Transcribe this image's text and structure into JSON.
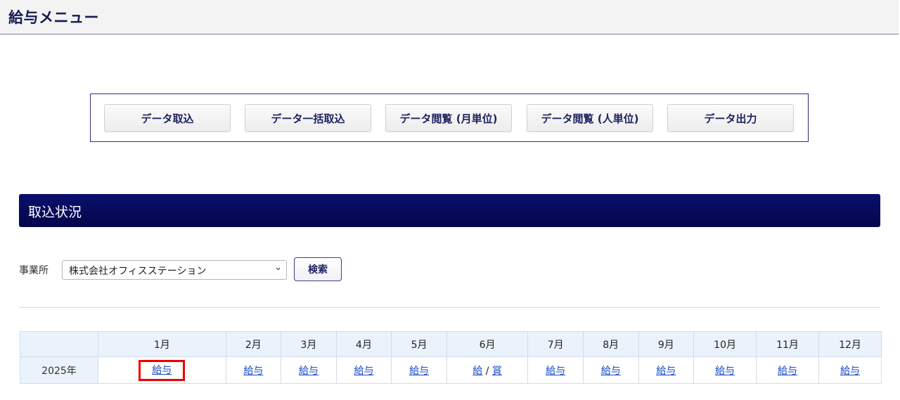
{
  "header": {
    "title": "給与メニュー"
  },
  "menu": {
    "buttons": [
      {
        "label": "データ取込"
      },
      {
        "label": "データ一括取込"
      },
      {
        "label": "データ閲覧 (月単位)"
      },
      {
        "label": "データ閲覧 (人単位)"
      },
      {
        "label": "データ出力"
      }
    ]
  },
  "section": {
    "title": "取込状況"
  },
  "filter": {
    "office_label": "事業所",
    "office_selected": "株式会社オフィスステーション",
    "search_label": "検索"
  },
  "table": {
    "months": [
      "1月",
      "2月",
      "3月",
      "4月",
      "5月",
      "6月",
      "7月",
      "8月",
      "9月",
      "10月",
      "11月",
      "12月"
    ],
    "rows": [
      {
        "year": "2025年",
        "cells": [
          {
            "links": [
              "給与"
            ],
            "highlighted": true
          },
          {
            "links": [
              "給与"
            ]
          },
          {
            "links": [
              "給与"
            ]
          },
          {
            "links": [
              "給与"
            ]
          },
          {
            "links": [
              "給与"
            ]
          },
          {
            "links": [
              "給",
              "賞"
            ],
            "separator": "/"
          },
          {
            "links": [
              "給与"
            ]
          },
          {
            "links": [
              "給与"
            ]
          },
          {
            "links": [
              "給与"
            ]
          },
          {
            "links": [
              "給与"
            ]
          },
          {
            "links": [
              "給与"
            ]
          },
          {
            "links": [
              "給与"
            ]
          }
        ]
      }
    ]
  },
  "colors": {
    "header_bg": "#f3f3f3",
    "section_bar": "#04074a",
    "link": "#1a4cc8",
    "table_header_bg": "#eaf3fb",
    "highlight": "#ee0000"
  }
}
